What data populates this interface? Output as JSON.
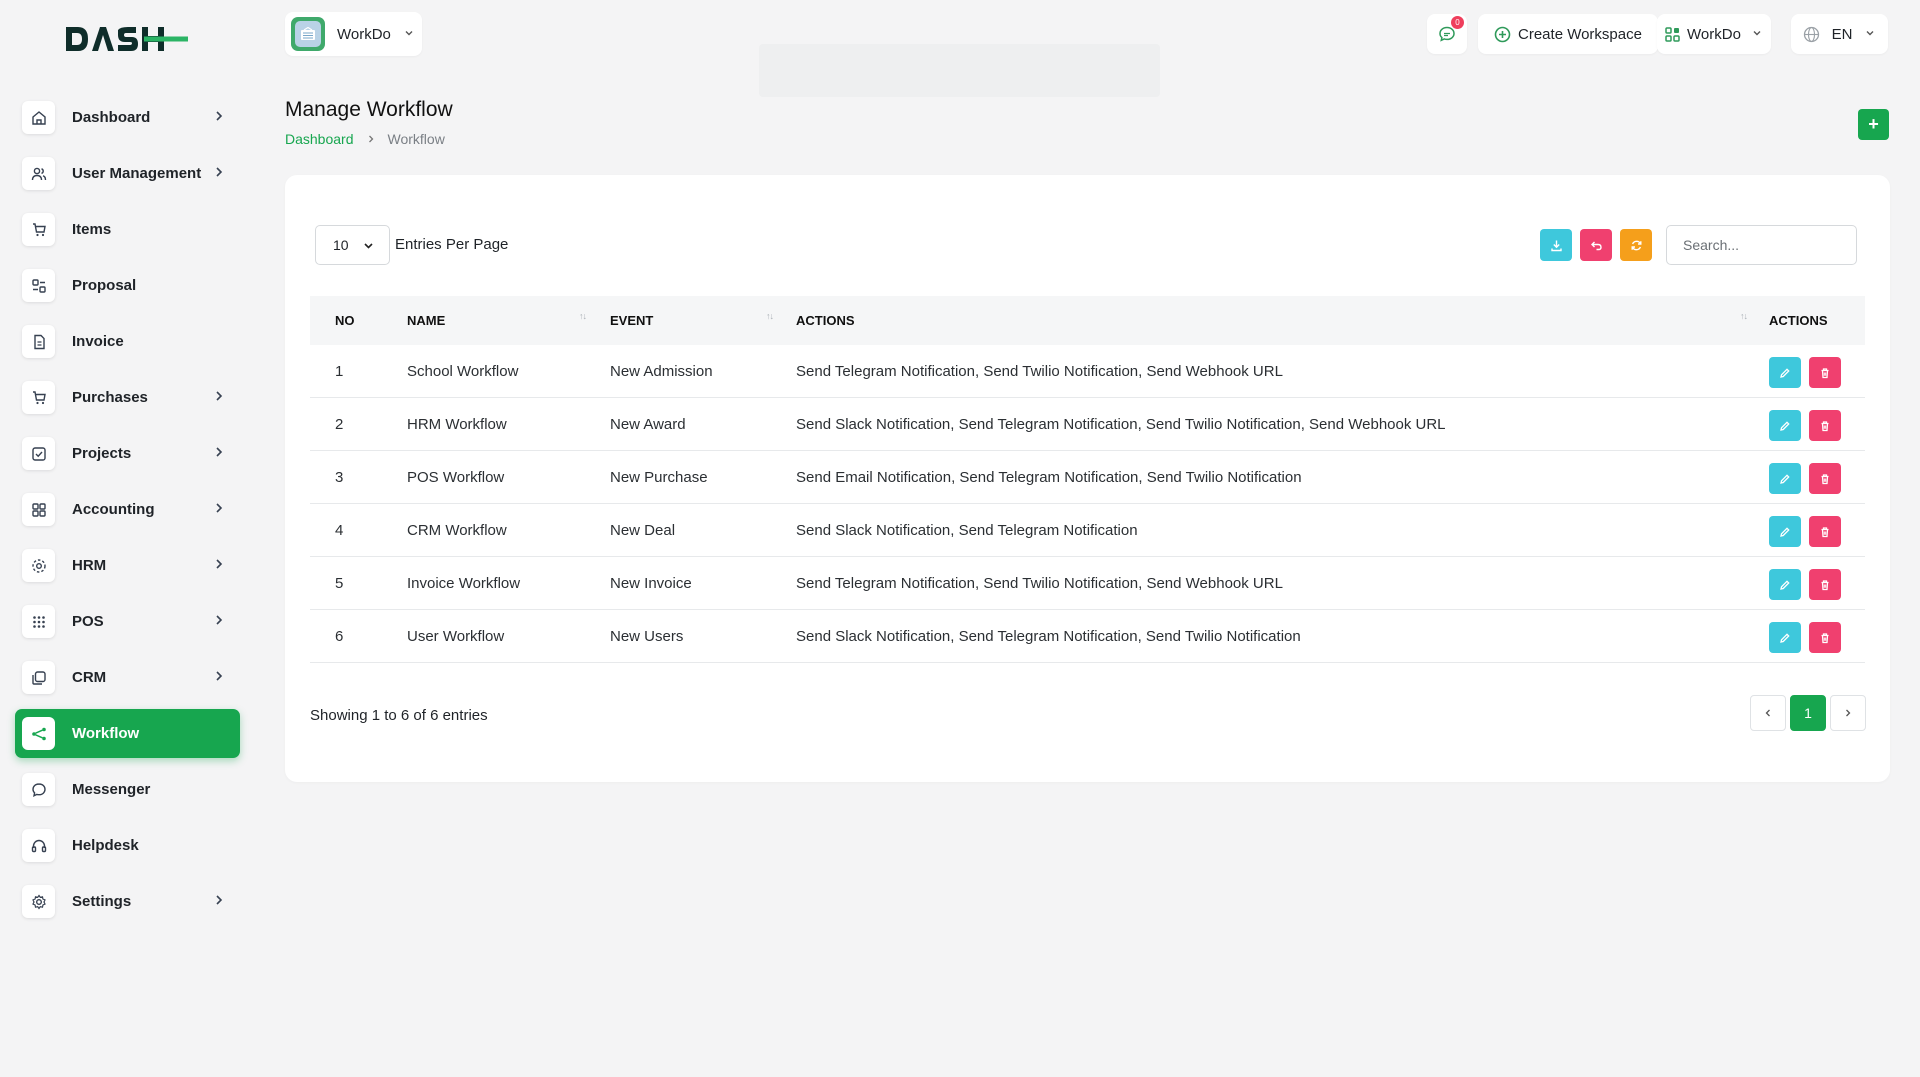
{
  "sidebar": {
    "logo_text": "DASH",
    "items": [
      {
        "label": "Dashboard",
        "icon": "home-icon",
        "chevron": true
      },
      {
        "label": "User Management",
        "icon": "users-icon",
        "chevron": true
      },
      {
        "label": "Items",
        "icon": "cart-icon",
        "chevron": false
      },
      {
        "label": "Proposal",
        "icon": "proposal-icon",
        "chevron": false
      },
      {
        "label": "Invoice",
        "icon": "file-icon",
        "chevron": false
      },
      {
        "label": "Purchases",
        "icon": "cart-icon",
        "chevron": true
      },
      {
        "label": "Projects",
        "icon": "check-square-icon",
        "chevron": true
      },
      {
        "label": "Accounting",
        "icon": "grid-icon",
        "chevron": true
      },
      {
        "label": "HRM",
        "icon": "hrm-icon",
        "chevron": true
      },
      {
        "label": "POS",
        "icon": "dots-grid-icon",
        "chevron": true
      },
      {
        "label": "CRM",
        "icon": "crm-icon",
        "chevron": true
      },
      {
        "label": "Workflow",
        "icon": "workflow-icon",
        "chevron": false,
        "active": true
      },
      {
        "label": "Messenger",
        "icon": "chat-icon",
        "chevron": false
      },
      {
        "label": "Helpdesk",
        "icon": "headset-icon",
        "chevron": false
      },
      {
        "label": "Settings",
        "icon": "gear-icon",
        "chevron": true
      }
    ]
  },
  "topbar": {
    "workspace_name": "WorkDo",
    "message_count": "0",
    "create_workspace": "Create Workspace",
    "workspace_menu": "WorkDo",
    "language": "EN"
  },
  "page": {
    "title": "Manage Workflow",
    "breadcrumb": {
      "home": "Dashboard",
      "current": "Workflow"
    },
    "add_label": "+"
  },
  "table_controls": {
    "per_page_value": "10",
    "per_page_label": "Entries Per Page",
    "search_placeholder": "Search..."
  },
  "table": {
    "headers": {
      "no": "NO",
      "name": "NAME",
      "event": "EVENT",
      "actions": "ACTIONS",
      "row_actions": "ACTIONS"
    },
    "rows": [
      {
        "no": "1",
        "name": "School Workflow",
        "event": "New Admission",
        "actions": "Send Telegram Notification, Send Twilio Notification, Send Webhook URL"
      },
      {
        "no": "2",
        "name": "HRM Workflow",
        "event": "New Award",
        "actions": "Send Slack Notification, Send Telegram Notification, Send Twilio Notification, Send Webhook URL"
      },
      {
        "no": "3",
        "name": "POS Workflow",
        "event": "New Purchase",
        "actions": "Send Email Notification, Send Telegram Notification, Send Twilio Notification"
      },
      {
        "no": "4",
        "name": "CRM Workflow",
        "event": "New Deal",
        "actions": "Send Slack Notification, Send Telegram Notification"
      },
      {
        "no": "5",
        "name": "Invoice Workflow",
        "event": "New Invoice",
        "actions": "Send Telegram Notification, Send Twilio Notification, Send Webhook URL"
      },
      {
        "no": "6",
        "name": "User Workflow",
        "event": "New Users",
        "actions": "Send Slack Notification, Send Telegram Notification, Send Twilio Notification"
      }
    ]
  },
  "footer": {
    "showing": "Showing 1 to 6 of 6 entries",
    "current_page": "1"
  },
  "colors": {
    "brand_green": "#17a64f",
    "edit_cyan": "#3ec8dc",
    "delete_pink": "#f0406f",
    "reload_orange": "#f59f1b"
  }
}
